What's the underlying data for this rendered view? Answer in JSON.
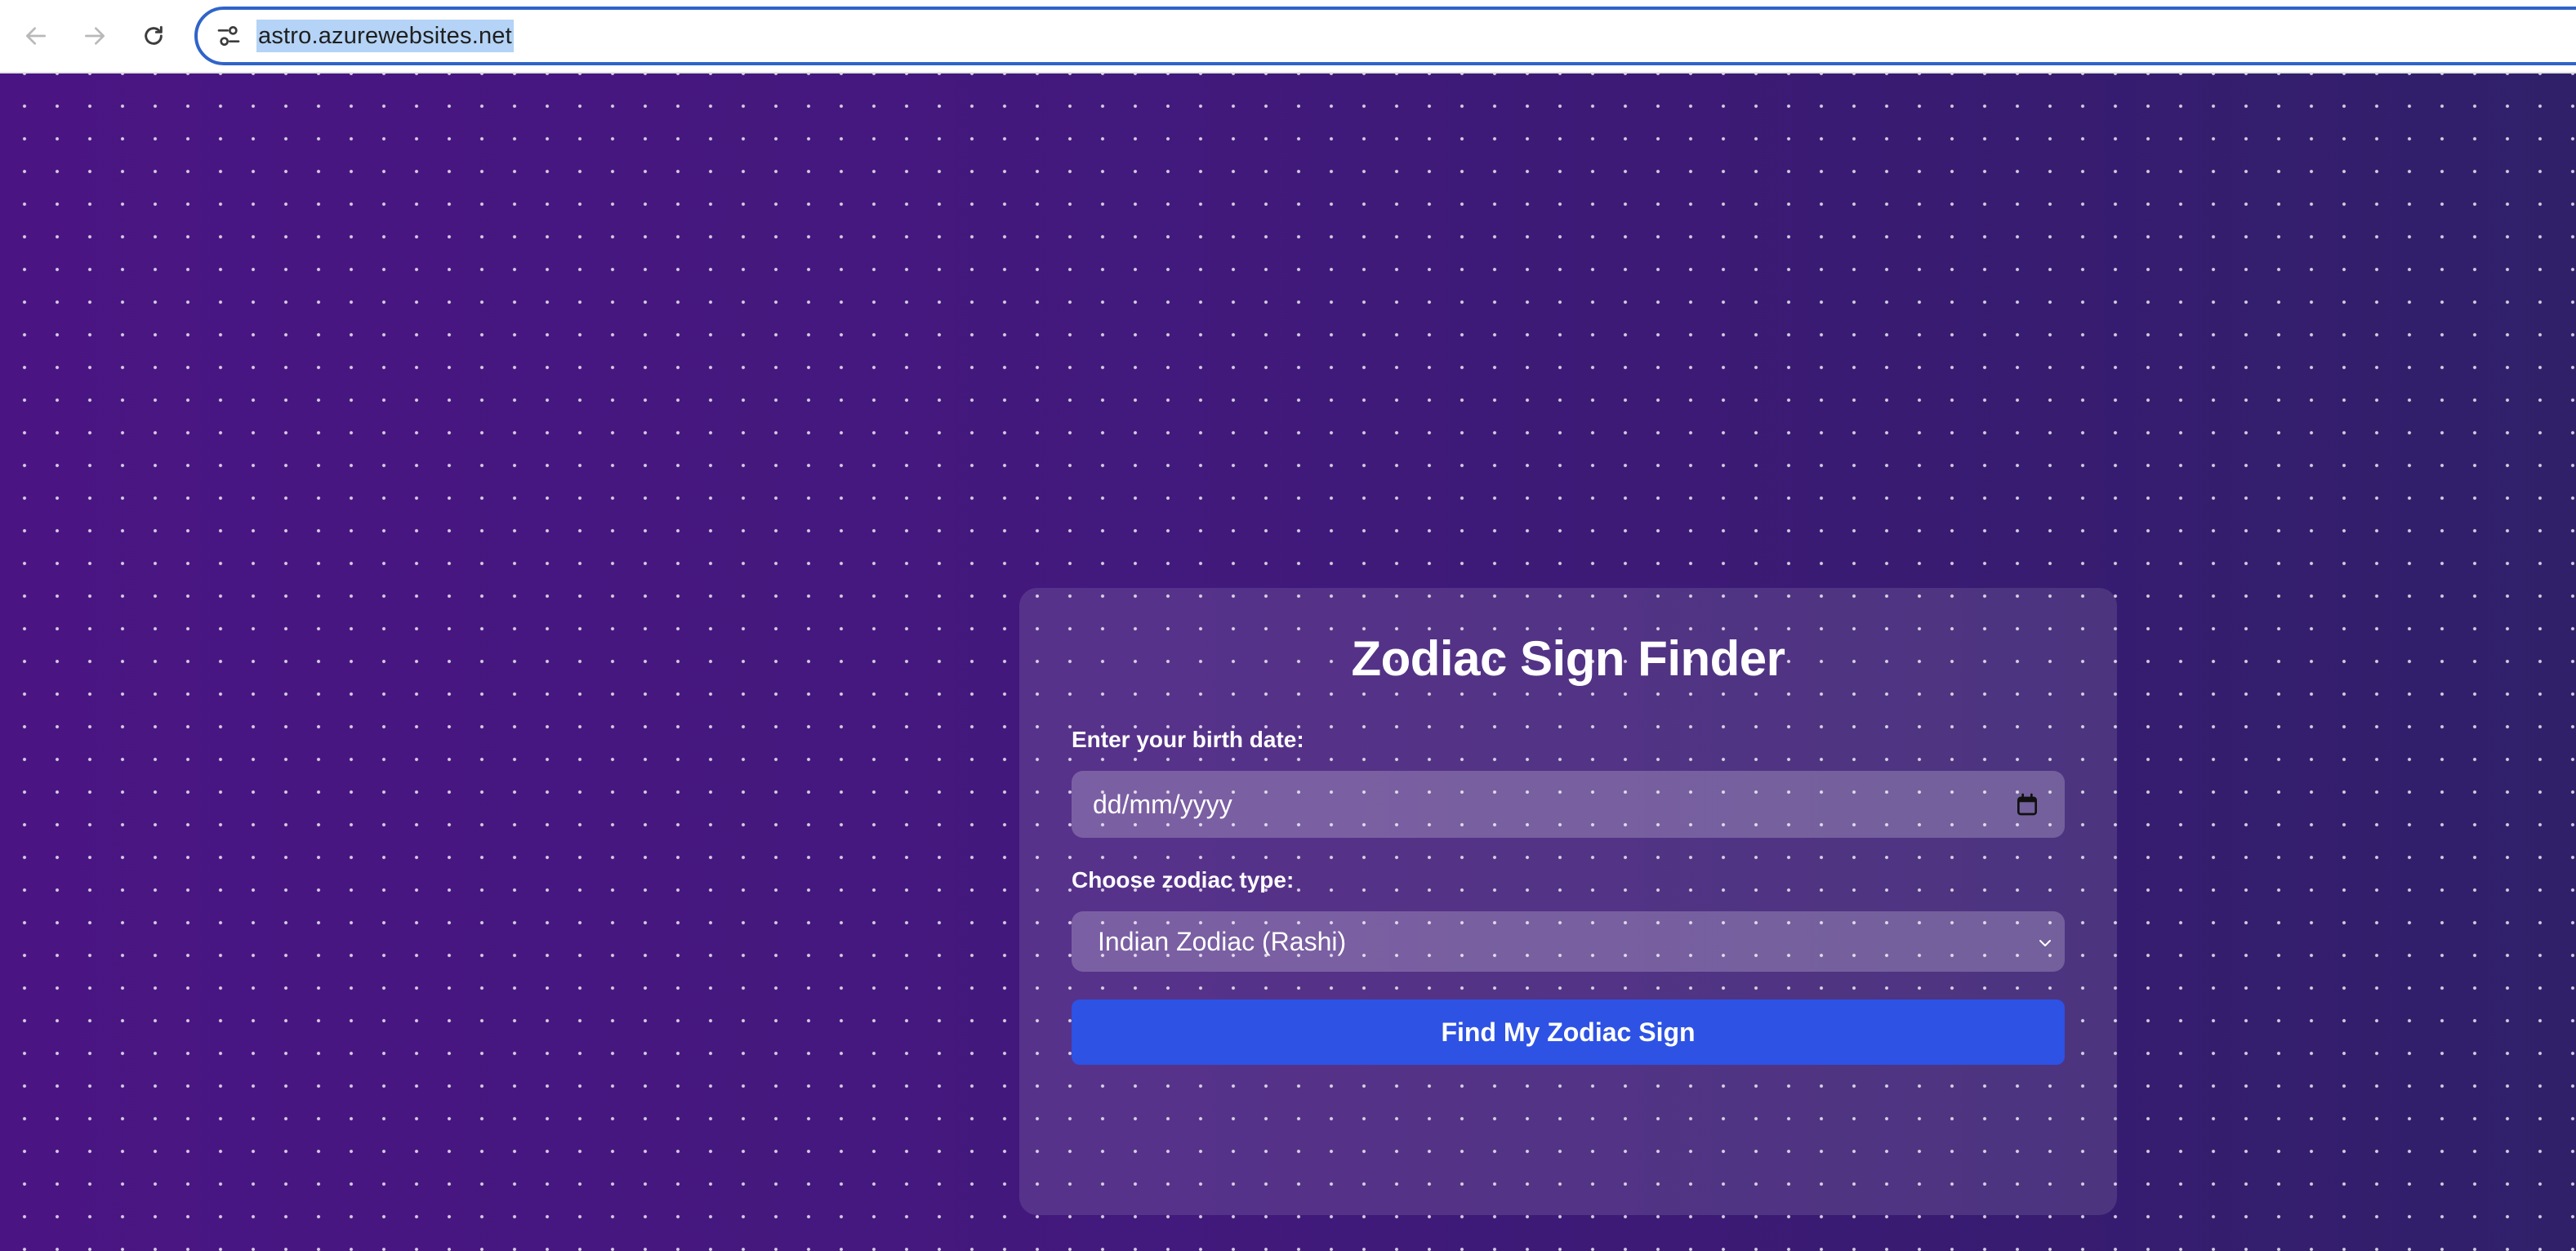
{
  "browser": {
    "url": "astro.azurewebsites.net",
    "icons": {
      "back": "arrow-left-icon",
      "forward": "arrow-right-icon",
      "reload": "reload-icon",
      "site_info": "tune-icon"
    },
    "colors": {
      "omnibox_border": "#2f64c9",
      "url_selection": "#b4d3f6"
    }
  },
  "page": {
    "background_gradient": [
      "#4a1583",
      "#30206a"
    ],
    "dot_pattern_color": "#ffffff",
    "card": {
      "title": "Zodiac Sign Finder",
      "birth_date": {
        "label": "Enter your birth date:",
        "placeholder": "dd/mm/yyyy",
        "icon": "calendar-icon"
      },
      "zodiac_type": {
        "label": "Choose zodiac type:",
        "selected": "Indian Zodiac (Rashi)",
        "icon": "chevron-down-icon"
      },
      "submit_label": "Find My Zodiac Sign",
      "accent_color": "#2d52e4"
    }
  }
}
